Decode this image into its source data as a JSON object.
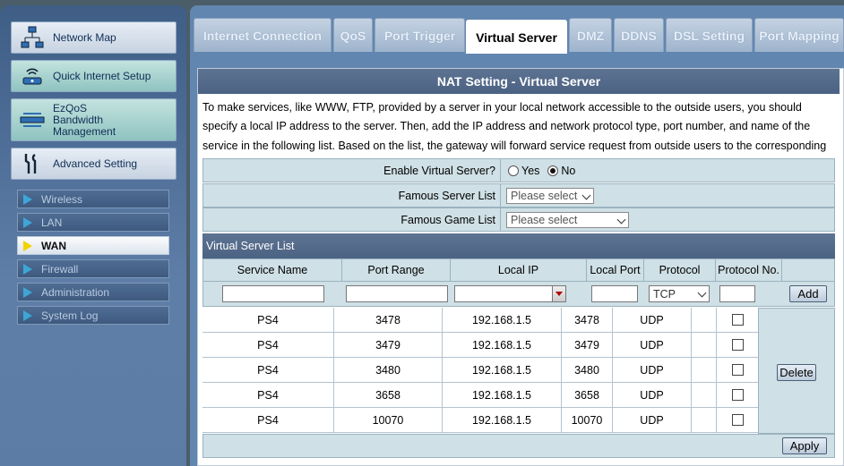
{
  "sidebar": {
    "menu": [
      {
        "label": "Network Map",
        "icon": "network-map-icon"
      },
      {
        "label": "Quick Internet Setup",
        "icon": "router-icon"
      },
      {
        "label": "EzQoS\nBandwidth\nManagement",
        "icon": "bandwidth-icon"
      },
      {
        "label": "Advanced Setting",
        "icon": "tools-icon"
      }
    ],
    "submenu": [
      "Wireless",
      "LAN",
      "WAN",
      "Firewall",
      "Administration",
      "System Log"
    ],
    "active_submenu": "WAN"
  },
  "tabs": [
    "Internet Connection",
    "QoS",
    "Port Trigger",
    "Virtual Server",
    "DMZ",
    "DDNS",
    "DSL Setting",
    "Port Mapping"
  ],
  "active_tab": "Virtual Server",
  "section_title": "NAT Setting - Virtual Server",
  "description": "To make services, like WWW, FTP, provided by a server in your local network accessible to the outside users, you should specify a local IP address to the server. Then, add the IP address and network protocol type, port number, and name of the service in the following list. Based on the list, the gateway will forward service request from outside users to the corresponding local server.",
  "form": {
    "enable_label": "Enable Virtual Server?",
    "yes_label": "Yes",
    "no_label": "No",
    "enabled": "No",
    "famous_server_label": "Famous Server List",
    "famous_server_value": "Please select",
    "famous_game_label": "Famous Game List",
    "famous_game_value": "Please select"
  },
  "list": {
    "title": "Virtual Server List",
    "headers": [
      "Service Name",
      "Port Range",
      "Local IP",
      "Local Port",
      "Protocol",
      "Protocol No."
    ],
    "protocol_default": "TCP",
    "add_label": "Add",
    "delete_label": "Delete",
    "apply_label": "Apply",
    "rows": [
      {
        "name": "PS4",
        "port_range": "3478",
        "ip": "192.168.1.5",
        "local_port": "3478",
        "protocol": "UDP"
      },
      {
        "name": "PS4",
        "port_range": "3479",
        "ip": "192.168.1.5",
        "local_port": "3479",
        "protocol": "UDP"
      },
      {
        "name": "PS4",
        "port_range": "3480",
        "ip": "192.168.1.5",
        "local_port": "3480",
        "protocol": "UDP"
      },
      {
        "name": "PS4",
        "port_range": "3658",
        "ip": "192.168.1.5",
        "local_port": "3658",
        "protocol": "UDP"
      },
      {
        "name": "PS4",
        "port_range": "10070",
        "ip": "192.168.1.5",
        "local_port": "10070",
        "protocol": "UDP"
      }
    ]
  }
}
